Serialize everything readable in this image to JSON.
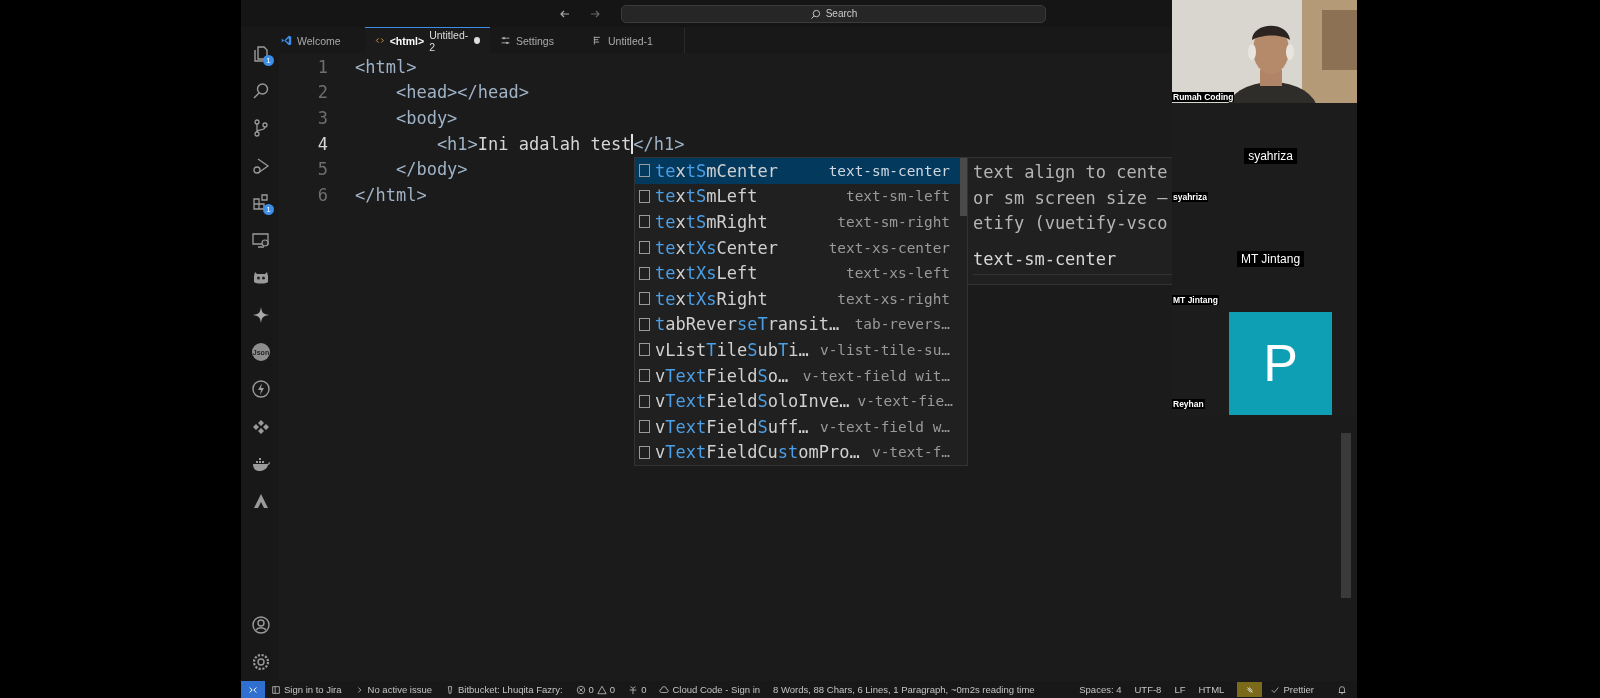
{
  "title_bar": {
    "search": {
      "placeholder": "Search"
    }
  },
  "activity_bar": {
    "items": [
      {
        "badge": "1",
        "selected": false
      },
      {
        "selected": false
      },
      {
        "selected": false
      },
      {
        "selected": false
      },
      {
        "badge": "1",
        "selected": false
      },
      {
        "selected": false
      },
      {
        "selected": false
      },
      {
        "selected": false
      },
      {
        "label": "Json",
        "selected": false
      },
      {
        "selected": false
      },
      {
        "selected": false
      },
      {
        "selected": false
      },
      {
        "selected": false
      }
    ]
  },
  "tabs": [
    {
      "title": "Welcome",
      "selected": false,
      "modified": false
    },
    {
      "prefix": "<html>",
      "title": "Untitled-2",
      "selected": true,
      "modified": true
    },
    {
      "title": "Settings",
      "selected": false,
      "modified": false
    },
    {
      "title": "Untitled-1",
      "selected": false,
      "modified": false
    }
  ],
  "editor": {
    "lines": [
      {
        "number": "1",
        "current": false,
        "segments": [
          {
            "kind": "tag",
            "text": "<html>"
          }
        ]
      },
      {
        "number": "2",
        "current": false,
        "segments": [
          {
            "kind": "tag",
            "text": "    <head></head>"
          }
        ]
      },
      {
        "number": "3",
        "current": false,
        "segments": [
          {
            "kind": "tag",
            "text": "    <body>"
          }
        ]
      },
      {
        "number": "4",
        "current": true,
        "segments": [
          {
            "kind": "tag",
            "text": "        <h1>"
          },
          {
            "kind": "text",
            "text": "Ini adalah test"
          },
          {
            "kind": "cursor"
          },
          {
            "kind": "tag",
            "text": "</h1>"
          }
        ]
      },
      {
        "number": "5",
        "current": false,
        "segments": [
          {
            "kind": "tag",
            "text": "    </body>"
          }
        ]
      },
      {
        "number": "6",
        "current": false,
        "segments": [
          {
            "kind": "tag",
            "text": "</html>"
          }
        ]
      }
    ],
    "suggestions": [
      {
        "label": [
          {
            "text": "te",
            "match": true
          },
          {
            "text": "x",
            "match": false
          },
          {
            "text": "tS",
            "match": true
          },
          {
            "text": "mCenter",
            "match": false
          }
        ],
        "detail": "text-sm-center",
        "selected": true
      },
      {
        "label": [
          {
            "text": "te",
            "match": true
          },
          {
            "text": "x",
            "match": false
          },
          {
            "text": "tS",
            "match": true
          },
          {
            "text": "mLeft",
            "match": false
          }
        ],
        "detail": "text-sm-left",
        "selected": false
      },
      {
        "label": [
          {
            "text": "te",
            "match": true
          },
          {
            "text": "x",
            "match": false
          },
          {
            "text": "tS",
            "match": true
          },
          {
            "text": "mRight",
            "match": false
          }
        ],
        "detail": "text-sm-right",
        "selected": false
      },
      {
        "label": [
          {
            "text": "te",
            "match": true
          },
          {
            "text": "x",
            "match": false
          },
          {
            "text": "tXs",
            "match": true
          },
          {
            "text": "Center",
            "match": false
          }
        ],
        "detail": "text-xs-center",
        "selected": false
      },
      {
        "label": [
          {
            "text": "te",
            "match": true
          },
          {
            "text": "x",
            "match": false
          },
          {
            "text": "tXs",
            "match": true
          },
          {
            "text": "Left",
            "match": false
          }
        ],
        "detail": "text-xs-left",
        "selected": false
      },
      {
        "label": [
          {
            "text": "te",
            "match": true
          },
          {
            "text": "x",
            "match": false
          },
          {
            "text": "tXs",
            "match": true
          },
          {
            "text": "Right",
            "match": false
          }
        ],
        "detail": "text-xs-right",
        "selected": false
      },
      {
        "label": [
          {
            "text": "t",
            "match": true
          },
          {
            "text": "abRever",
            "match": false
          },
          {
            "text": "seT",
            "match": true
          },
          {
            "text": "ransit…",
            "match": false
          }
        ],
        "detail": "tab-revers…",
        "selected": false
      },
      {
        "label": [
          {
            "text": "vList",
            "match": false
          },
          {
            "text": "T",
            "match": true
          },
          {
            "text": "ile",
            "match": false
          },
          {
            "text": "S",
            "match": true
          },
          {
            "text": "ub",
            "match": false
          },
          {
            "text": "T",
            "match": true
          },
          {
            "text": "i…",
            "match": false
          }
        ],
        "detail": "v-list-tile-su…",
        "selected": false
      },
      {
        "label": [
          {
            "text": "v",
            "match": false
          },
          {
            "text": "Text",
            "match": true
          },
          {
            "text": "Field",
            "match": false
          },
          {
            "text": "S",
            "match": true
          },
          {
            "text": "o…",
            "match": false
          }
        ],
        "detail": "v-text-field wit…",
        "selected": false
      },
      {
        "label": [
          {
            "text": "v",
            "match": false
          },
          {
            "text": "Text",
            "match": true
          },
          {
            "text": "Field",
            "match": false
          },
          {
            "text": "S",
            "match": true
          },
          {
            "text": "oloInve…",
            "match": false
          }
        ],
        "detail": "v-text-fie…",
        "selected": false
      },
      {
        "label": [
          {
            "text": "v",
            "match": false
          },
          {
            "text": "Text",
            "match": true
          },
          {
            "text": "Field",
            "match": false
          },
          {
            "text": "S",
            "match": true
          },
          {
            "text": "uff…",
            "match": false
          }
        ],
        "detail": "v-text-field w…",
        "selected": false
      },
      {
        "label": [
          {
            "text": "v",
            "match": false
          },
          {
            "text": "Text",
            "match": true
          },
          {
            "text": "FieldCu",
            "match": false
          },
          {
            "text": "st",
            "match": true
          },
          {
            "text": "omPro…",
            "match": false
          }
        ],
        "detail": "v-text-f…",
        "selected": false
      }
    ],
    "suggestion_doc": {
      "lines": [
        "text align to cente",
        "or sm screen size –",
        "etify (vuetify-vsco"
      ],
      "signature": "text-sm-center"
    }
  },
  "participants": [
    {
      "kind": "video",
      "name": "Rumah Coding"
    },
    {
      "kind": "name",
      "name": "syahriza",
      "caption": "syahriza"
    },
    {
      "kind": "name",
      "name": "MT Jintang",
      "caption": "MT Jintang"
    },
    {
      "kind": "avatar",
      "initial": "P",
      "color": "#0f9fb4",
      "caption": "Reyhan"
    }
  ],
  "status_bar": {
    "items": [
      {
        "kind": "remote"
      },
      {
        "kind": "jira",
        "text": "Sign in to Jira"
      },
      {
        "kind": "issue",
        "text": "No active issue"
      },
      {
        "kind": "bitbucket",
        "text": "Bitbucket: Lhuqita Fazry:"
      },
      {
        "kind": "problems",
        "errors": "0",
        "warnings": "0"
      },
      {
        "kind": "ports",
        "text": "0"
      },
      {
        "kind": "cloud",
        "text": "Cloud Code - Sign in"
      },
      {
        "kind": "text",
        "text": "8 Words, 88 Chars, 6 Lines, 1 Paragraph, ~0m2s reading time"
      },
      {
        "kind": "spacer"
      },
      {
        "kind": "text",
        "text": "Spaces: 4"
      },
      {
        "kind": "text",
        "text": "UTF-8"
      },
      {
        "kind": "text",
        "text": "LF"
      },
      {
        "kind": "text",
        "text": "HTML"
      },
      {
        "kind": "feedback"
      },
      {
        "kind": "prettier",
        "text": "Prettier"
      },
      {
        "kind": "bell"
      }
    ]
  }
}
